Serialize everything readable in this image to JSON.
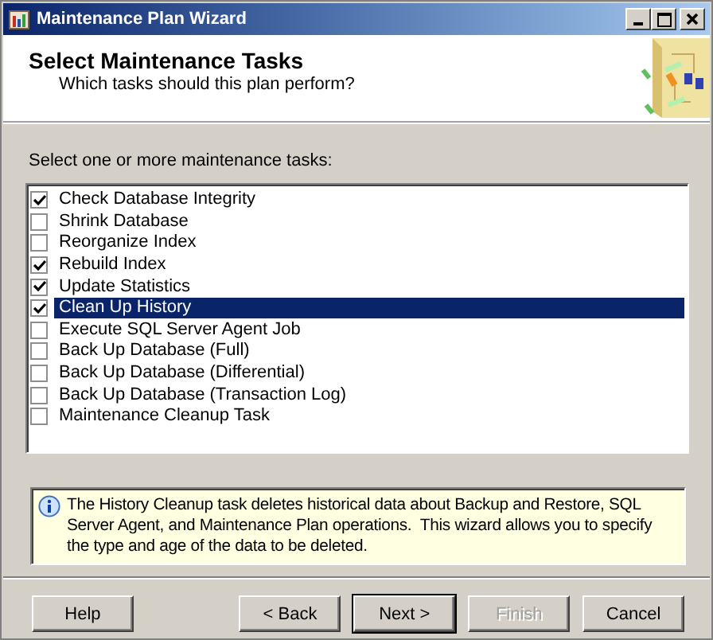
{
  "window": {
    "title": "Maintenance Plan Wizard"
  },
  "header": {
    "title": "Select Maintenance Tasks",
    "subtitle": "Which tasks should this plan perform?"
  },
  "prompt": "Select one or more maintenance tasks:",
  "tasks": [
    {
      "label": "Check Database Integrity",
      "checked": true,
      "selected": false
    },
    {
      "label": "Shrink Database",
      "checked": false,
      "selected": false
    },
    {
      "label": "Reorganize Index",
      "checked": false,
      "selected": false
    },
    {
      "label": "Rebuild Index",
      "checked": true,
      "selected": false
    },
    {
      "label": "Update Statistics",
      "checked": true,
      "selected": false
    },
    {
      "label": "Clean Up History",
      "checked": true,
      "selected": true
    },
    {
      "label": "Execute SQL Server Agent Job",
      "checked": false,
      "selected": false
    },
    {
      "label": "Back Up Database (Full)",
      "checked": false,
      "selected": false
    },
    {
      "label": "Back Up Database (Differential)",
      "checked": false,
      "selected": false
    },
    {
      "label": "Back Up Database (Transaction Log)",
      "checked": false,
      "selected": false
    },
    {
      "label": "Maintenance Cleanup Task",
      "checked": false,
      "selected": false
    }
  ],
  "info": "The History Cleanup task deletes historical data about Backup and Restore, SQL Server Agent, and Maintenance Plan operations.  This wizard allows you to specify the type and age of the data to be deleted.",
  "buttons": [
    {
      "label": "Help",
      "default": false,
      "disabled": false
    },
    {
      "label": "< Back",
      "default": false,
      "disabled": false
    },
    {
      "label": "Next >",
      "default": true,
      "disabled": false
    },
    {
      "label": "Finish",
      "default": false,
      "disabled": true
    },
    {
      "label": "Cancel",
      "default": false,
      "disabled": false
    }
  ]
}
